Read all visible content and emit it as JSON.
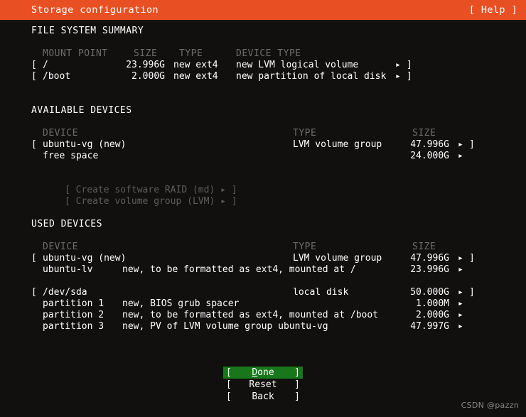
{
  "header": {
    "title": "Storage configuration",
    "help_label": "[ Help ]",
    "bar_color": "#E85023"
  },
  "filesystem_summary": {
    "section_title": "FILE SYSTEM SUMMARY",
    "columns": {
      "mount_point": "MOUNT POINT",
      "size": "SIZE",
      "type": "TYPE",
      "device_type": "DEVICE TYPE"
    },
    "rows": [
      {
        "open_bracket": "[",
        "mount_point": "/",
        "size": "23.996G",
        "type": "new ext4",
        "device_type": "new LVM logical volume",
        "arrow": "▸",
        "close_bracket": "]"
      },
      {
        "open_bracket": "[",
        "mount_point": "/boot",
        "size": "2.000G",
        "type": "new ext4",
        "device_type": "new partition of local disk",
        "arrow": "▸",
        "close_bracket": "]"
      }
    ]
  },
  "available_devices": {
    "section_title": "AVAILABLE DEVICES",
    "columns": {
      "device": "DEVICE",
      "type": "TYPE",
      "size": "SIZE"
    },
    "rows": [
      {
        "open_bracket": "[",
        "device": "ubuntu-vg (new)",
        "type": "LVM volume group",
        "size": "47.996G",
        "arrow": "▸",
        "close_bracket": "]"
      },
      {
        "open_bracket": "",
        "device": "free space",
        "type": "",
        "size": "24.000G",
        "arrow": "▸",
        "close_bracket": ""
      }
    ],
    "actions": [
      {
        "label": "[ Create software RAID (md) ▸ ]",
        "enabled": false
      },
      {
        "label": "[ Create volume group (LVM) ▸ ]",
        "enabled": false
      }
    ]
  },
  "used_devices": {
    "section_title": "USED DEVICES",
    "columns": {
      "device": "DEVICE",
      "type": "TYPE",
      "size": "SIZE"
    },
    "group_one": [
      {
        "open_bracket": "[",
        "device": "ubuntu-vg (new)",
        "type": "LVM volume group",
        "size": "47.996G",
        "arrow": "▸",
        "close_bracket": "]"
      },
      {
        "open_bracket": "",
        "device": "ubuntu-lv",
        "type": "new, to be formatted as ext4, mounted at /",
        "size": "23.996G",
        "arrow": "▸",
        "close_bracket": ""
      }
    ],
    "group_two": [
      {
        "open_bracket": "[",
        "device": "/dev/sda",
        "type": "local disk",
        "size": "50.000G",
        "arrow": "▸",
        "close_bracket": "]"
      },
      {
        "open_bracket": "",
        "device": "partition 1",
        "type": "new, BIOS grub spacer",
        "size": "1.000M",
        "arrow": "▸",
        "close_bracket": ""
      },
      {
        "open_bracket": "",
        "device": "partition 2",
        "type": "new, to be formatted as ext4, mounted at /boot",
        "size": "2.000G",
        "arrow": "▸",
        "close_bracket": ""
      },
      {
        "open_bracket": "",
        "device": "partition 3",
        "type": "new, PV of LVM volume group ubuntu-vg",
        "size": "47.997G",
        "arrow": "▸",
        "close_bracket": ""
      }
    ]
  },
  "footer_buttons": [
    {
      "open_bracket": "[",
      "accel": "D",
      "rest": "one",
      "close_bracket": "]",
      "selected": true,
      "highlight_color": "#18771B"
    },
    {
      "open_bracket": "[",
      "accel": "",
      "rest": "Reset",
      "close_bracket": "]",
      "selected": false,
      "highlight_color": ""
    },
    {
      "open_bracket": "[",
      "accel": "",
      "rest": "Back",
      "close_bracket": "]",
      "selected": false,
      "highlight_color": ""
    }
  ],
  "watermark": "CSDN @pazzn"
}
